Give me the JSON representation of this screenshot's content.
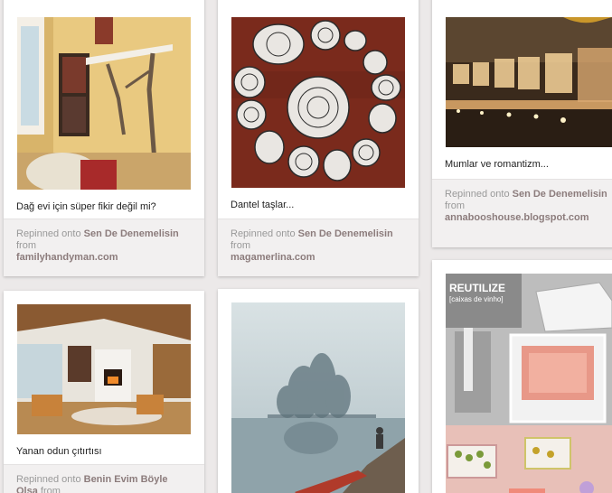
{
  "pins": [
    {
      "id": "pin1",
      "description": "Dağ evi için süper fikir değil mi?",
      "repinned_prefix": "Repinned onto",
      "board": "Sen De Denemelisin",
      "from_word": "from",
      "source": "familyhandyman.com"
    },
    {
      "id": "pin2",
      "description": "Dantel taşlar...",
      "repinned_prefix": "Repinned onto",
      "board": "Sen De Denemelisin",
      "from_word": "from",
      "source": "magamerlina.com"
    },
    {
      "id": "pin3",
      "description": "Mumlar ve romantizm...",
      "repinned_prefix": "Repinned onto",
      "board": "Sen De Denemelisin",
      "from_word": "from",
      "source": "annabooshouse.blogspot.com"
    },
    {
      "id": "pin4",
      "description": "Yanan odun çıtırtısı",
      "repinned_prefix": "Repinned onto",
      "board": "Benin Evim Böyle Olsa",
      "from_word": "from",
      "source": ""
    },
    {
      "id": "pin5",
      "description": "",
      "repinned_prefix": "",
      "board": "",
      "from_word": "",
      "source": ""
    },
    {
      "id": "pin6",
      "image_title": "REUTILIZE",
      "image_subtitle": "[caixas de vinho]"
    }
  ],
  "colors": {
    "page_bg": "#ece9e9",
    "card_bg": "#ffffff",
    "credit_bg": "#f2f0f0",
    "board_text": "#8c7c7c"
  }
}
